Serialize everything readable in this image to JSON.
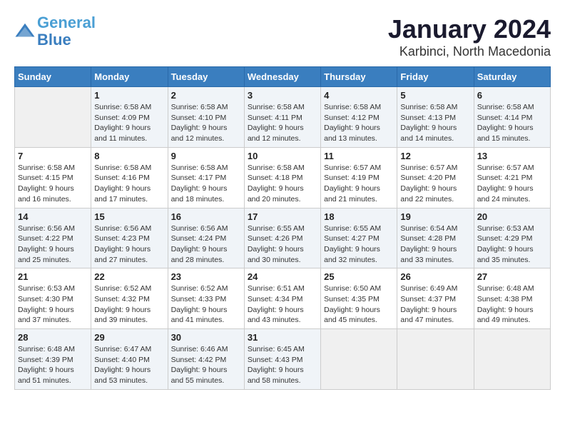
{
  "header": {
    "logo_line1": "General",
    "logo_line2": "Blue",
    "title": "January 2024",
    "subtitle": "Karbinci, North Macedonia"
  },
  "weekdays": [
    "Sunday",
    "Monday",
    "Tuesday",
    "Wednesday",
    "Thursday",
    "Friday",
    "Saturday"
  ],
  "weeks": [
    [
      {
        "day": "",
        "sunrise": "",
        "sunset": "",
        "daylight": ""
      },
      {
        "day": "1",
        "sunrise": "Sunrise: 6:58 AM",
        "sunset": "Sunset: 4:09 PM",
        "daylight": "Daylight: 9 hours and 11 minutes."
      },
      {
        "day": "2",
        "sunrise": "Sunrise: 6:58 AM",
        "sunset": "Sunset: 4:10 PM",
        "daylight": "Daylight: 9 hours and 12 minutes."
      },
      {
        "day": "3",
        "sunrise": "Sunrise: 6:58 AM",
        "sunset": "Sunset: 4:11 PM",
        "daylight": "Daylight: 9 hours and 12 minutes."
      },
      {
        "day": "4",
        "sunrise": "Sunrise: 6:58 AM",
        "sunset": "Sunset: 4:12 PM",
        "daylight": "Daylight: 9 hours and 13 minutes."
      },
      {
        "day": "5",
        "sunrise": "Sunrise: 6:58 AM",
        "sunset": "Sunset: 4:13 PM",
        "daylight": "Daylight: 9 hours and 14 minutes."
      },
      {
        "day": "6",
        "sunrise": "Sunrise: 6:58 AM",
        "sunset": "Sunset: 4:14 PM",
        "daylight": "Daylight: 9 hours and 15 minutes."
      }
    ],
    [
      {
        "day": "7",
        "sunrise": "Sunrise: 6:58 AM",
        "sunset": "Sunset: 4:15 PM",
        "daylight": "Daylight: 9 hours and 16 minutes."
      },
      {
        "day": "8",
        "sunrise": "Sunrise: 6:58 AM",
        "sunset": "Sunset: 4:16 PM",
        "daylight": "Daylight: 9 hours and 17 minutes."
      },
      {
        "day": "9",
        "sunrise": "Sunrise: 6:58 AM",
        "sunset": "Sunset: 4:17 PM",
        "daylight": "Daylight: 9 hours and 18 minutes."
      },
      {
        "day": "10",
        "sunrise": "Sunrise: 6:58 AM",
        "sunset": "Sunset: 4:18 PM",
        "daylight": "Daylight: 9 hours and 20 minutes."
      },
      {
        "day": "11",
        "sunrise": "Sunrise: 6:57 AM",
        "sunset": "Sunset: 4:19 PM",
        "daylight": "Daylight: 9 hours and 21 minutes."
      },
      {
        "day": "12",
        "sunrise": "Sunrise: 6:57 AM",
        "sunset": "Sunset: 4:20 PM",
        "daylight": "Daylight: 9 hours and 22 minutes."
      },
      {
        "day": "13",
        "sunrise": "Sunrise: 6:57 AM",
        "sunset": "Sunset: 4:21 PM",
        "daylight": "Daylight: 9 hours and 24 minutes."
      }
    ],
    [
      {
        "day": "14",
        "sunrise": "Sunrise: 6:56 AM",
        "sunset": "Sunset: 4:22 PM",
        "daylight": "Daylight: 9 hours and 25 minutes."
      },
      {
        "day": "15",
        "sunrise": "Sunrise: 6:56 AM",
        "sunset": "Sunset: 4:23 PM",
        "daylight": "Daylight: 9 hours and 27 minutes."
      },
      {
        "day": "16",
        "sunrise": "Sunrise: 6:56 AM",
        "sunset": "Sunset: 4:24 PM",
        "daylight": "Daylight: 9 hours and 28 minutes."
      },
      {
        "day": "17",
        "sunrise": "Sunrise: 6:55 AM",
        "sunset": "Sunset: 4:26 PM",
        "daylight": "Daylight: 9 hours and 30 minutes."
      },
      {
        "day": "18",
        "sunrise": "Sunrise: 6:55 AM",
        "sunset": "Sunset: 4:27 PM",
        "daylight": "Daylight: 9 hours and 32 minutes."
      },
      {
        "day": "19",
        "sunrise": "Sunrise: 6:54 AM",
        "sunset": "Sunset: 4:28 PM",
        "daylight": "Daylight: 9 hours and 33 minutes."
      },
      {
        "day": "20",
        "sunrise": "Sunrise: 6:53 AM",
        "sunset": "Sunset: 4:29 PM",
        "daylight": "Daylight: 9 hours and 35 minutes."
      }
    ],
    [
      {
        "day": "21",
        "sunrise": "Sunrise: 6:53 AM",
        "sunset": "Sunset: 4:30 PM",
        "daylight": "Daylight: 9 hours and 37 minutes."
      },
      {
        "day": "22",
        "sunrise": "Sunrise: 6:52 AM",
        "sunset": "Sunset: 4:32 PM",
        "daylight": "Daylight: 9 hours and 39 minutes."
      },
      {
        "day": "23",
        "sunrise": "Sunrise: 6:52 AM",
        "sunset": "Sunset: 4:33 PM",
        "daylight": "Daylight: 9 hours and 41 minutes."
      },
      {
        "day": "24",
        "sunrise": "Sunrise: 6:51 AM",
        "sunset": "Sunset: 4:34 PM",
        "daylight": "Daylight: 9 hours and 43 minutes."
      },
      {
        "day": "25",
        "sunrise": "Sunrise: 6:50 AM",
        "sunset": "Sunset: 4:35 PM",
        "daylight": "Daylight: 9 hours and 45 minutes."
      },
      {
        "day": "26",
        "sunrise": "Sunrise: 6:49 AM",
        "sunset": "Sunset: 4:37 PM",
        "daylight": "Daylight: 9 hours and 47 minutes."
      },
      {
        "day": "27",
        "sunrise": "Sunrise: 6:48 AM",
        "sunset": "Sunset: 4:38 PM",
        "daylight": "Daylight: 9 hours and 49 minutes."
      }
    ],
    [
      {
        "day": "28",
        "sunrise": "Sunrise: 6:48 AM",
        "sunset": "Sunset: 4:39 PM",
        "daylight": "Daylight: 9 hours and 51 minutes."
      },
      {
        "day": "29",
        "sunrise": "Sunrise: 6:47 AM",
        "sunset": "Sunset: 4:40 PM",
        "daylight": "Daylight: 9 hours and 53 minutes."
      },
      {
        "day": "30",
        "sunrise": "Sunrise: 6:46 AM",
        "sunset": "Sunset: 4:42 PM",
        "daylight": "Daylight: 9 hours and 55 minutes."
      },
      {
        "day": "31",
        "sunrise": "Sunrise: 6:45 AM",
        "sunset": "Sunset: 4:43 PM",
        "daylight": "Daylight: 9 hours and 58 minutes."
      },
      {
        "day": "",
        "sunrise": "",
        "sunset": "",
        "daylight": ""
      },
      {
        "day": "",
        "sunrise": "",
        "sunset": "",
        "daylight": ""
      },
      {
        "day": "",
        "sunrise": "",
        "sunset": "",
        "daylight": ""
      }
    ]
  ]
}
